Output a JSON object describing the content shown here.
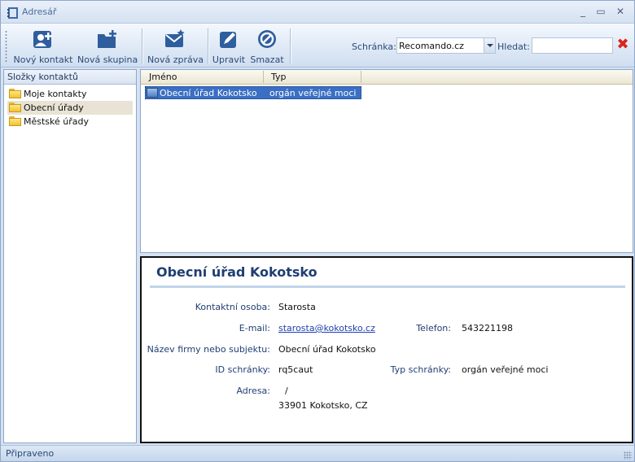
{
  "window": {
    "title": "Adresář"
  },
  "toolbar": {
    "new_contact": "Nový kontakt",
    "new_group": "Nová skupina",
    "new_message": "Nová zpráva",
    "edit": "Upravit",
    "delete": "Smazat",
    "mailbox_label": "Schránka:",
    "mailbox_value": "Recomando.cz",
    "search_label": "Hledat:",
    "search_value": ""
  },
  "sidebar": {
    "header": "Složky kontaktů",
    "items": [
      {
        "label": "Moje kontakty",
        "selected": false
      },
      {
        "label": "Obecní úřady",
        "selected": true
      },
      {
        "label": "Městské úřady",
        "selected": false
      }
    ]
  },
  "list": {
    "columns": [
      "Jméno",
      "Typ"
    ],
    "rows": [
      {
        "name": "Obecní úřad Kokotsko",
        "type": "orgán veřejné moci"
      }
    ]
  },
  "detail": {
    "title": "Obecní úřad Kokotsko",
    "contact_label": "Kontaktní osoba:",
    "contact_value": "Starosta",
    "email_label": "E-mail:",
    "email_value": "starosta@kokotsko.cz",
    "phone_label": "Telefon:",
    "phone_value": "543221198",
    "company_label": "Název firmy nebo subjektu:",
    "company_value": "Obecní úřad Kokotsko",
    "box_id_label": "ID schránky:",
    "box_id_value": "rq5caut",
    "box_type_label": "Typ schránky:",
    "box_type_value": "orgán veřejné moci",
    "address_label": "Adresa:",
    "address_line1": "/",
    "address_line2": "33901 Kokotsko, CZ"
  },
  "status": {
    "text": "Připraveno"
  },
  "colors": {
    "accent": "#1f3e73",
    "selection": "#3a6fc4",
    "delete": "#d9241c"
  }
}
